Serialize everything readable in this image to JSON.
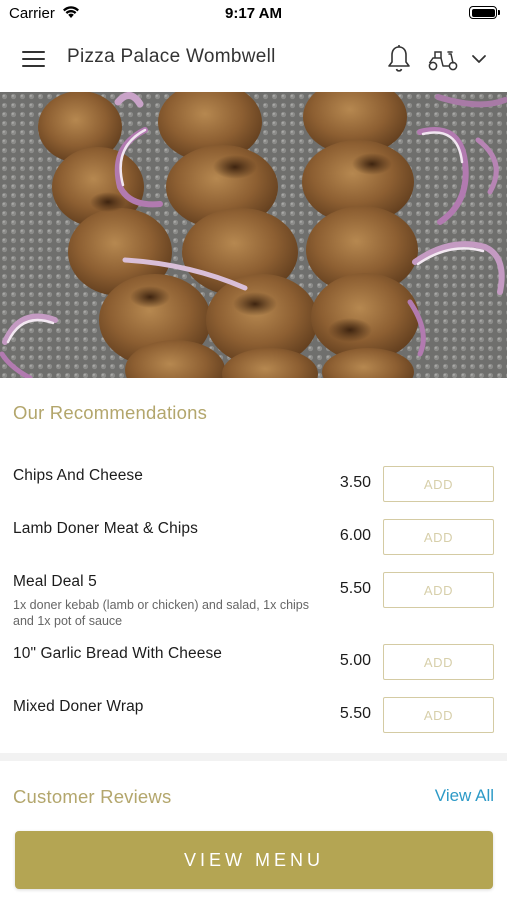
{
  "status_bar": {
    "carrier": "Carrier",
    "time": "9:17 AM"
  },
  "nav": {
    "title": "Pizza Palace Wombwell",
    "icons": [
      "menu-icon",
      "bell-icon",
      "scooter-icon",
      "chevron-down-icon"
    ]
  },
  "hero": {
    "image": "grilled chicken kebab skewers with red onion on grill tray"
  },
  "recommendations": {
    "title": "Our Recommendations",
    "add_label": "ADD",
    "items": [
      {
        "name": "Chips And Cheese",
        "description": "",
        "price": "3.50"
      },
      {
        "name": "Lamb Doner Meat & Chips",
        "description": "",
        "price": "6.00"
      },
      {
        "name": "Meal Deal 5",
        "description": "1x doner kebab (lamb or chicken) and salad, 1x chips and 1x pot of sauce",
        "price": "5.50"
      },
      {
        "name": "10\" Garlic Bread With Cheese",
        "description": "",
        "price": "5.00"
      },
      {
        "name": "Mixed Doner Wrap",
        "description": "",
        "price": "5.50"
      }
    ]
  },
  "reviews": {
    "title": "Customer Reviews",
    "view_all": "View All"
  },
  "footer": {
    "view_menu": "VIEW MENU"
  },
  "colors": {
    "accent_gold": "#b4a553",
    "section_title": "#b3a66c",
    "link_blue": "#2d9ac7"
  }
}
